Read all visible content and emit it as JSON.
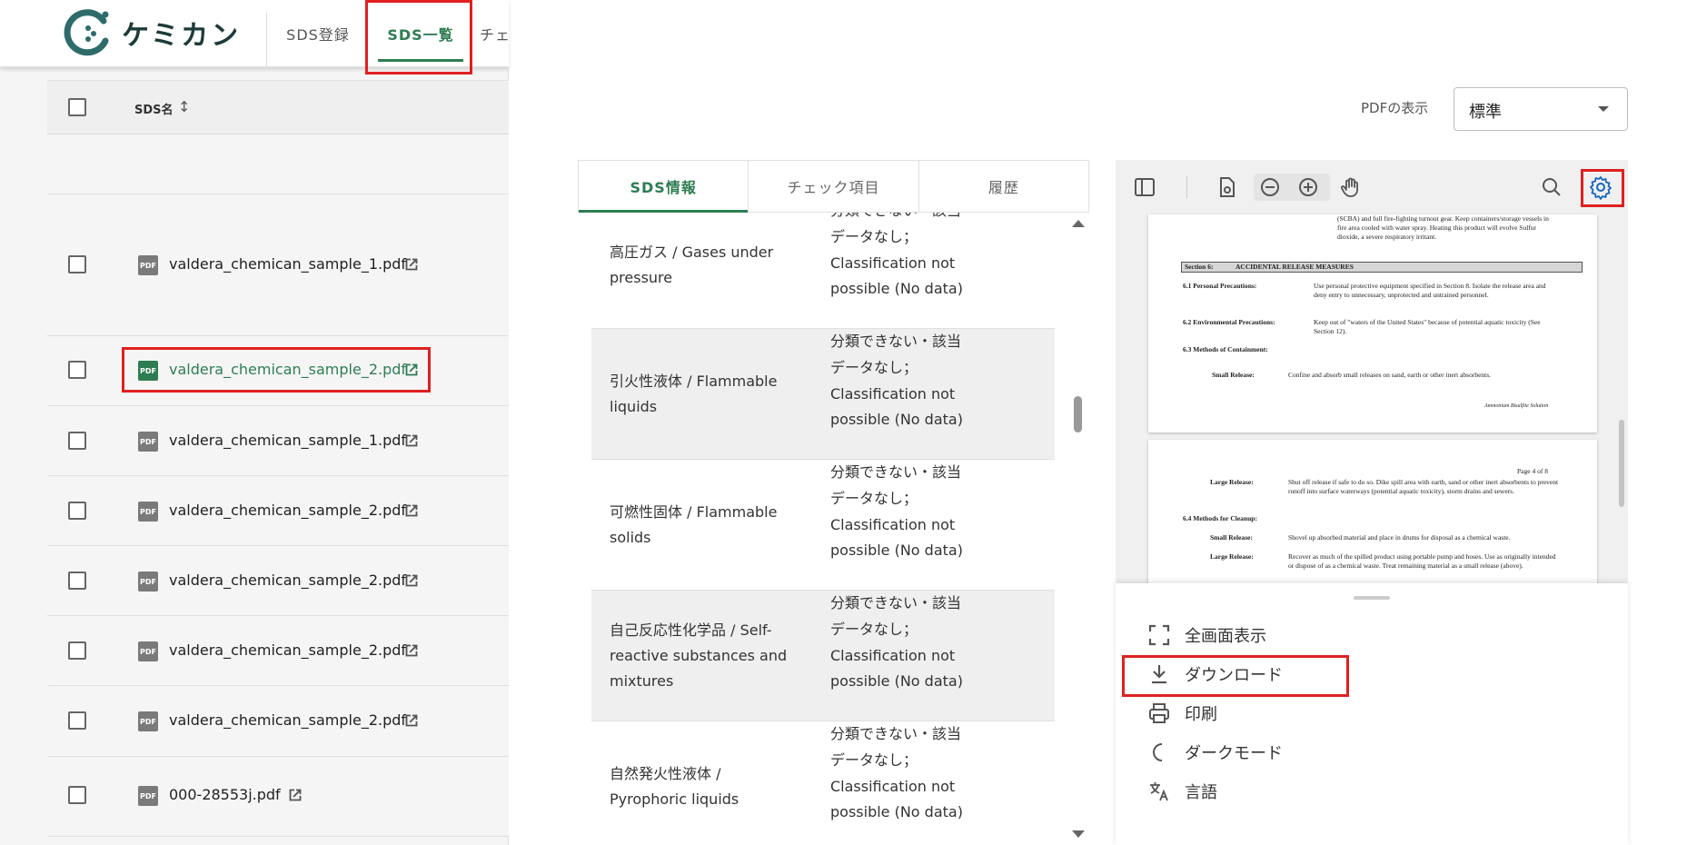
{
  "app": {
    "name": "ケミカン"
  },
  "topnav": {
    "register": "SDS登録",
    "list": "SDS一覧",
    "check": "チェ"
  },
  "list": {
    "header": {
      "name_col": "SDS名"
    },
    "rows": [
      {
        "file": "valdera_chemican_sample_1.pdf"
      },
      {
        "file": "valdera_chemican_sample_2.pdf"
      },
      {
        "file": "valdera_chemican_sample_1.pdf"
      },
      {
        "file": "valdera_chemican_sample_2.pdf"
      },
      {
        "file": "valdera_chemican_sample_2.pdf"
      },
      {
        "file": "valdera_chemican_sample_2.pdf"
      },
      {
        "file": "valdera_chemican_sample_2.pdf"
      },
      {
        "file": "000-28553j.pdf"
      }
    ],
    "pdf_badge": "PDF"
  },
  "pdf_display": {
    "label": "PDFの表示",
    "value": "標準"
  },
  "tabs": {
    "info": "SDS情報",
    "check": "チェック項目",
    "history": "履歴"
  },
  "hazards": [
    {
      "name": "高圧ガス / Gases under pressure",
      "value": "分類できない・該当データなし；Classification not possible (No data)"
    },
    {
      "name": "引火性液体 / Flammable liquids",
      "value": "分類できない・該当データなし；Classification not possible (No data)"
    },
    {
      "name": "可燃性固体 / Flammable solids",
      "value": "分類できない・該当データなし；Classification not possible (No data)"
    },
    {
      "name": "自己反応性化学品 / Self-reactive substances and mixtures",
      "value": "分類できない・該当データなし；Classification not possible (No data)"
    },
    {
      "name": "自然発火性液体 / Pyrophoric liquids",
      "value": "分類できない・該当データなし；Classification not possible (No data)"
    }
  ],
  "pdf": {
    "page1_top": "(SCBA) and full fire-fighting turnout gear. Keep containers/storage vessels in fire area cooled with water spray. Heating this product will evolve Sulfur dioxide, a severe respiratory irritant.",
    "section_num": "Section 6:",
    "section_title": "ACCIDENTAL RELEASE MEASURES",
    "s61_label": "6.1 Personal Precautions:",
    "s61_text": "Use personal protective equipment specified in Section 8. Isolate the release area and deny entry to unnecessary, unprotected and untrained personnel.",
    "s62_label": "6.2 Environmental Precautions:",
    "s62_text": "Keep out of \"waters of the United States\" because of potential aquatic toxicity (See Section 12).",
    "s63_label": "6.3 Methods of Containment:",
    "small_release_label": "Small Release:",
    "small_release_text": "Confine and absorb small releases on sand, earth or other inert absorbents.",
    "footer": "Ammonium Bisulfite Solution",
    "page_no": "Page 4 of 8",
    "large_release_label": "Large Release:",
    "large_release_text": "Shut off release if safe to do so. Dike spill area with earth, sand or other inert absorbents to prevent runoff into surface waterways (potential aquatic toxicity), storm drains and sewers.",
    "s64_label": "6.4 Methods for Cleanup:",
    "small_release2_text": "Shovel up absorbed material and place in drums for disposal as a chemical waste.",
    "large_release2_text": "Recover as much of the spilled product using portable pump and hoses. Use as originally intended or dispose of as a chemical waste. Treat remaining material as a small release (above)."
  },
  "settings_menu": {
    "fullscreen": "全画面表示",
    "download": "ダウンロード",
    "print": "印刷",
    "dark_mode": "ダークモード",
    "language": "言語"
  },
  "colors": {
    "accent": "#2e7d52",
    "highlight": "#e02020"
  }
}
